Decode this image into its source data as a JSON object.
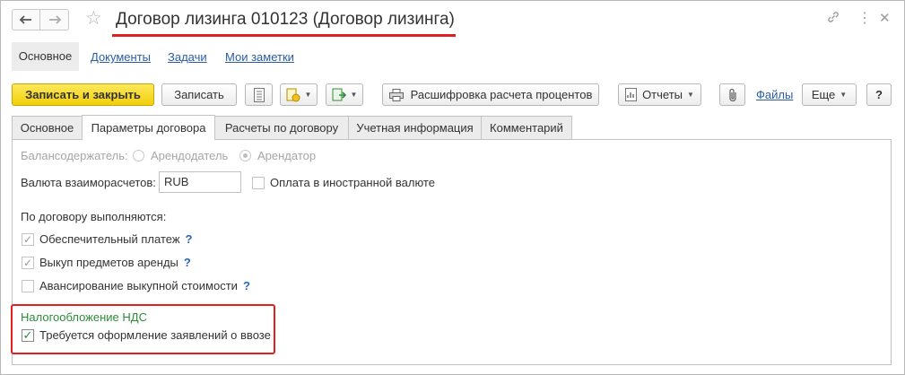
{
  "window": {
    "title": "Договор лизинга 010123 (Договор лизинга)",
    "nav_back_icon": "arrow-left-icon",
    "nav_forward_icon": "arrow-right-icon",
    "favorite_icon": "star-icon",
    "link_icon": "link-icon",
    "more_icon": "vertical-dots-icon",
    "close_icon": "close-icon"
  },
  "nav": {
    "main": "Основное",
    "documents": "Документы",
    "tasks": "Задачи",
    "notes": "Мои заметки"
  },
  "toolbar": {
    "save_close": "Записать и закрыть",
    "save": "Записать",
    "interest_breakdown": "Расшифровка расчета процентов",
    "reports": "Отчеты",
    "files": "Файлы",
    "more": "Еще",
    "help": "?"
  },
  "tabs": [
    {
      "label": "Основное",
      "active": false
    },
    {
      "label": "Параметры договора",
      "active": true
    },
    {
      "label": "Расчеты по договору",
      "active": false
    },
    {
      "label": "Учетная информация",
      "active": false
    },
    {
      "label": "Комментарий",
      "active": false
    }
  ],
  "form": {
    "balance_holder_label": "Балансодержатель:",
    "option_lessor": "Арендодатель",
    "option_lessee": "Арендатор",
    "selected_option": "Арендатор",
    "currency_label": "Валюта взаиморасчетов:",
    "currency_value": "RUB",
    "foreign_currency_payment": "Оплата в иностранной валюте",
    "foreign_currency_checked": false,
    "performed_label": "По договору выполняются:",
    "security_payment": "Обеспечительный платеж",
    "security_payment_checked": true,
    "buyout": "Выкуп предметов аренды",
    "buyout_checked": true,
    "advance_buyout": "Авансирование выкупной стоимости",
    "advance_buyout_checked": false,
    "help_mark": "?",
    "vat_section": "Налогообложение НДС",
    "import_statements": "Требуется оформление заявлений о ввозе",
    "import_statements_checked": true
  },
  "colors": {
    "primary_button": "#f5d51f",
    "link": "#2a5ba8",
    "section_heading": "#2e8b3a",
    "annotation": "#e0201c"
  }
}
